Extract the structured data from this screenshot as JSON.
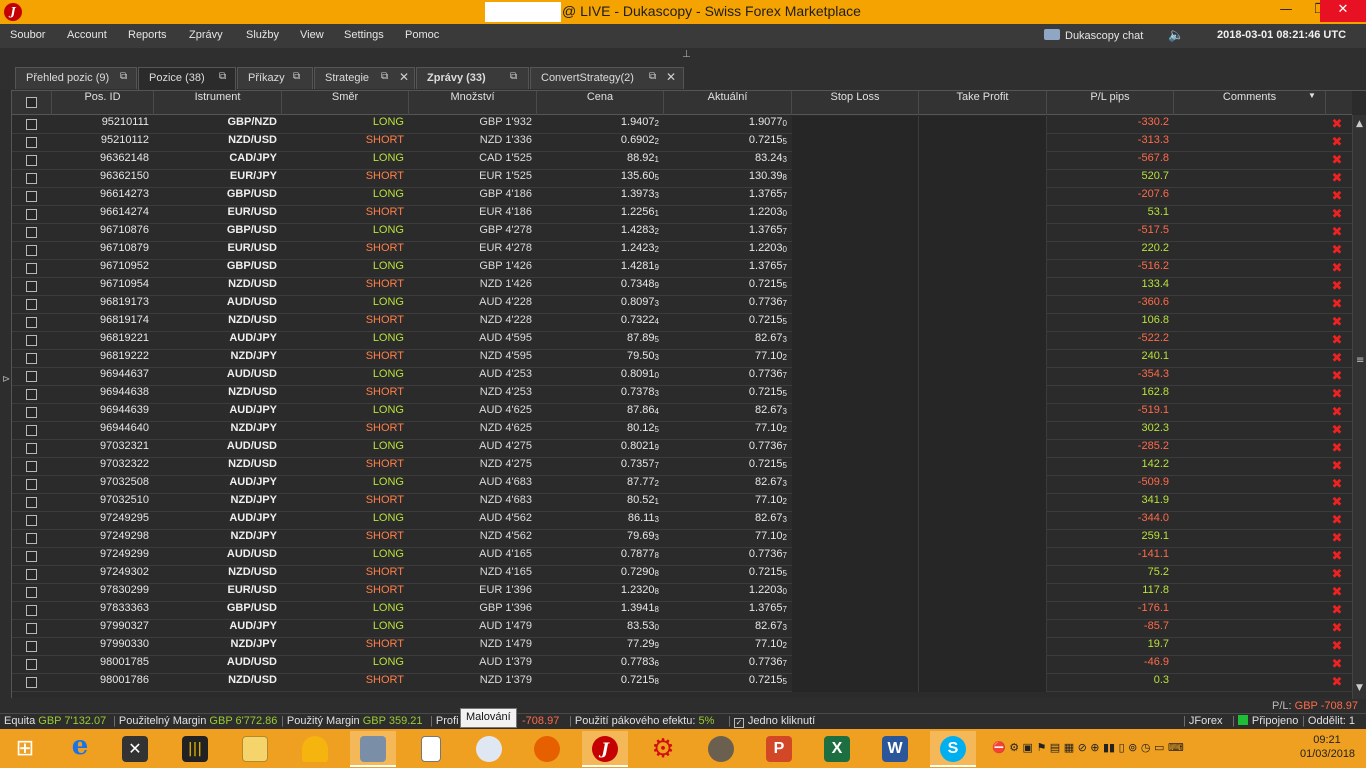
{
  "window": {
    "title": "@ LIVE - Dukascopy - Swiss Forex Marketplace",
    "clock": "2018-03-01 08:21:46 UTC",
    "chat_label": "Dukascopy chat"
  },
  "menu": [
    "Soubor",
    "Account",
    "Reports",
    "Zprávy",
    "Služby",
    "View",
    "Settings",
    "Pomoc"
  ],
  "tabs": [
    {
      "label": "Přehled pozic (9)",
      "closable": false,
      "active": false,
      "bold": false
    },
    {
      "label": "Pozice (38)",
      "closable": false,
      "active": true,
      "bold": false
    },
    {
      "label": "Příkazy",
      "closable": false,
      "active": false,
      "bold": false
    },
    {
      "label": "Strategie",
      "closable": true,
      "active": false,
      "bold": false
    },
    {
      "label": "Zprávy (33)",
      "closable": false,
      "active": false,
      "bold": true
    },
    {
      "label": "ConvertStrategy(2)",
      "closable": true,
      "active": false,
      "bold": false
    }
  ],
  "table": {
    "headers": [
      "Pos. ID",
      "Istrument",
      "Směr",
      "Množství",
      "Cena",
      "Aktuální",
      "Stop Loss",
      "Take Profit",
      "P/L pips",
      "Comments"
    ],
    "rows": [
      [
        "95210111",
        "GBP/NZD",
        "LONG",
        "GBP 1'932",
        "1.9407",
        "2",
        "1.9077",
        "0",
        "-330.2"
      ],
      [
        "95210112",
        "NZD/USD",
        "SHORT",
        "NZD 1'336",
        "0.6902",
        "2",
        "0.7215",
        "5",
        "-313.3"
      ],
      [
        "96362148",
        "CAD/JPY",
        "LONG",
        "CAD 1'525",
        "88.92",
        "1",
        "83.24",
        "3",
        "-567.8"
      ],
      [
        "96362150",
        "EUR/JPY",
        "SHORT",
        "EUR 1'525",
        "135.60",
        "5",
        "130.39",
        "8",
        "520.7"
      ],
      [
        "96614273",
        "GBP/USD",
        "LONG",
        "GBP 4'186",
        "1.3973",
        "3",
        "1.3765",
        "7",
        "-207.6"
      ],
      [
        "96614274",
        "EUR/USD",
        "SHORT",
        "EUR 4'186",
        "1.2256",
        "1",
        "1.2203",
        "0",
        "53.1"
      ],
      [
        "96710876",
        "GBP/USD",
        "LONG",
        "GBP 4'278",
        "1.4283",
        "2",
        "1.3765",
        "7",
        "-517.5"
      ],
      [
        "96710879",
        "EUR/USD",
        "SHORT",
        "EUR 4'278",
        "1.2423",
        "2",
        "1.2203",
        "0",
        "220.2"
      ],
      [
        "96710952",
        "GBP/USD",
        "LONG",
        "GBP 1'426",
        "1.4281",
        "9",
        "1.3765",
        "7",
        "-516.2"
      ],
      [
        "96710954",
        "NZD/USD",
        "SHORT",
        "NZD 1'426",
        "0.7348",
        "9",
        "0.7215",
        "5",
        "133.4"
      ],
      [
        "96819173",
        "AUD/USD",
        "LONG",
        "AUD 4'228",
        "0.8097",
        "3",
        "0.7736",
        "7",
        "-360.6"
      ],
      [
        "96819174",
        "NZD/USD",
        "SHORT",
        "NZD 4'228",
        "0.7322",
        "4",
        "0.7215",
        "5",
        "106.8"
      ],
      [
        "96819221",
        "AUD/JPY",
        "LONG",
        "AUD 4'595",
        "87.89",
        "5",
        "82.67",
        "3",
        "-522.2"
      ],
      [
        "96819222",
        "NZD/JPY",
        "SHORT",
        "NZD 4'595",
        "79.50",
        "3",
        "77.10",
        "2",
        "240.1"
      ],
      [
        "96944637",
        "AUD/USD",
        "LONG",
        "AUD 4'253",
        "0.8091",
        "0",
        "0.7736",
        "7",
        "-354.3"
      ],
      [
        "96944638",
        "NZD/USD",
        "SHORT",
        "NZD 4'253",
        "0.7378",
        "3",
        "0.7215",
        "5",
        "162.8"
      ],
      [
        "96944639",
        "AUD/JPY",
        "LONG",
        "AUD 4'625",
        "87.86",
        "4",
        "82.67",
        "3",
        "-519.1"
      ],
      [
        "96944640",
        "NZD/JPY",
        "SHORT",
        "NZD 4'625",
        "80.12",
        "5",
        "77.10",
        "2",
        "302.3"
      ],
      [
        "97032321",
        "AUD/USD",
        "LONG",
        "AUD 4'275",
        "0.8021",
        "9",
        "0.7736",
        "7",
        "-285.2"
      ],
      [
        "97032322",
        "NZD/USD",
        "SHORT",
        "NZD 4'275",
        "0.7357",
        "7",
        "0.7215",
        "5",
        "142.2"
      ],
      [
        "97032508",
        "AUD/JPY",
        "LONG",
        "AUD 4'683",
        "87.77",
        "2",
        "82.67",
        "3",
        "-509.9"
      ],
      [
        "97032510",
        "NZD/JPY",
        "SHORT",
        "NZD 4'683",
        "80.52",
        "1",
        "77.10",
        "2",
        "341.9"
      ],
      [
        "97249295",
        "AUD/JPY",
        "LONG",
        "AUD 4'562",
        "86.11",
        "3",
        "82.67",
        "3",
        "-344.0"
      ],
      [
        "97249298",
        "NZD/JPY",
        "SHORT",
        "NZD 4'562",
        "79.69",
        "3",
        "77.10",
        "2",
        "259.1"
      ],
      [
        "97249299",
        "AUD/USD",
        "LONG",
        "AUD 4'165",
        "0.7877",
        "8",
        "0.7736",
        "7",
        "-141.1"
      ],
      [
        "97249302",
        "NZD/USD",
        "SHORT",
        "NZD 4'165",
        "0.7290",
        "8",
        "0.7215",
        "5",
        "75.2"
      ],
      [
        "97830299",
        "EUR/USD",
        "SHORT",
        "EUR 1'396",
        "1.2320",
        "8",
        "1.2203",
        "0",
        "117.8"
      ],
      [
        "97833363",
        "GBP/USD",
        "LONG",
        "GBP 1'396",
        "1.3941",
        "8",
        "1.3765",
        "7",
        "-176.1"
      ],
      [
        "97990327",
        "AUD/JPY",
        "LONG",
        "AUD 1'479",
        "83.53",
        "0",
        "82.67",
        "3",
        "-85.7"
      ],
      [
        "97990330",
        "NZD/JPY",
        "SHORT",
        "NZD 1'479",
        "77.29",
        "9",
        "77.10",
        "2",
        "19.7"
      ],
      [
        "98001785",
        "AUD/USD",
        "LONG",
        "AUD 1'379",
        "0.7783",
        "6",
        "0.7736",
        "7",
        "-46.9"
      ],
      [
        "98001786",
        "NZD/USD",
        "SHORT",
        "NZD 1'379",
        "0.7215",
        "8",
        "0.7215",
        "5",
        "0.3"
      ]
    ]
  },
  "pl_total": {
    "label": "P/L:",
    "value": "GBP -708.97"
  },
  "status": {
    "equity_label": "Equita",
    "equity_value": "GBP 7'132.07",
    "usable_label": "Použitelný Margin",
    "usable_value": "GBP 6'772.86",
    "used_label": "Použitý Margin",
    "used_value": "GBP 359.21",
    "profit_label": "Profi",
    "profit_value": "-708.97",
    "tooltip": "Malování",
    "leverage_label": "Použití pákového efektu:",
    "leverage_value": "5%",
    "oneclick_label": "Jedno kliknutí",
    "jforex": "JForex",
    "connected": "Připojeno",
    "detach": "Oddělit: 1"
  },
  "taskbar": {
    "time": "09:21",
    "date": "01/03/2018"
  },
  "colors": {
    "long": "#b9e23c",
    "short": "#ff7f4a",
    "titlebar": "#f5a300",
    "delete": "#e22222"
  }
}
